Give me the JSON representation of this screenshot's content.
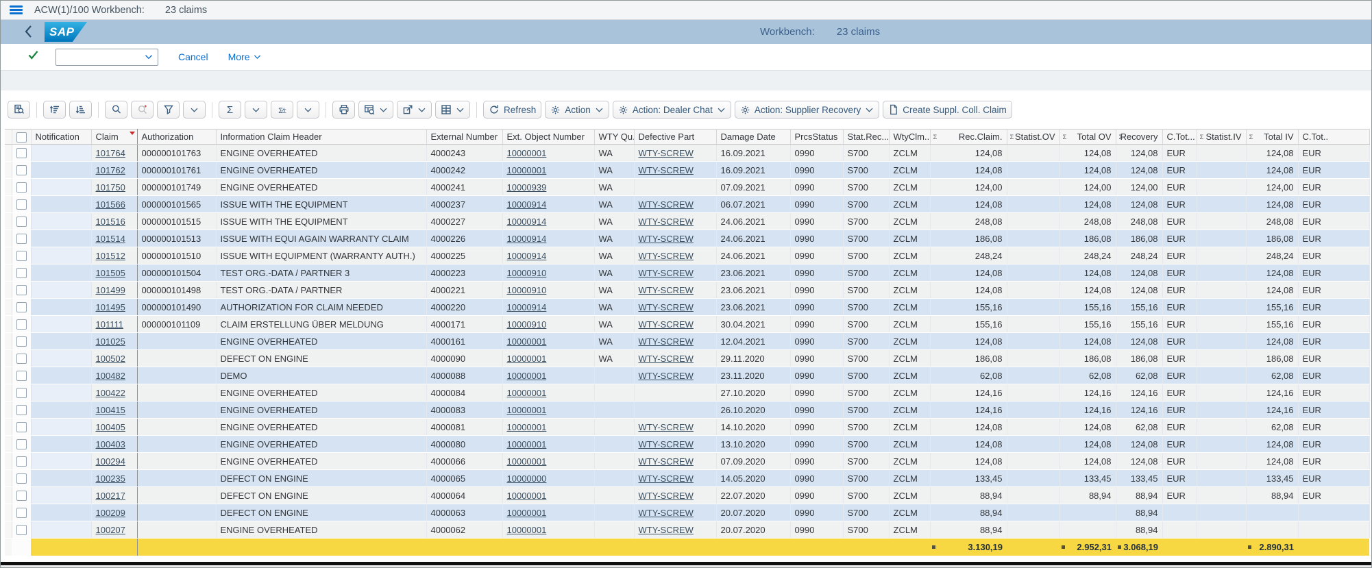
{
  "shell_bar": {
    "title": "ACW(1)/100 Workbench:",
    "claims_count": "23 claims"
  },
  "header_bar": {
    "logo_text": "SAP",
    "workbench_label": "Workbench:",
    "workbench_value": "23 claims"
  },
  "ok_code_bar": {
    "ok_field_value": "",
    "cancel_label": "Cancel",
    "more_label": "More"
  },
  "toolbar": {
    "buttons": [
      {
        "icon": "display-details-icon"
      },
      {
        "sep": true
      },
      {
        "icon": "sort-ascending-icon"
      },
      {
        "icon": "sort-descending-icon"
      },
      {
        "sep": true
      },
      {
        "icon": "find-icon"
      },
      {
        "icon": "find-next-icon",
        "disabled": true
      },
      {
        "icon": "filter-icon"
      },
      {
        "icon": "chevron-down-icon"
      },
      {
        "sep": true
      },
      {
        "icon": "sum-icon"
      },
      {
        "icon": "chevron-down-icon"
      },
      {
        "icon": "subtotal-icon"
      },
      {
        "icon": "chevron-down-icon"
      },
      {
        "sep": true
      },
      {
        "icon": "print-icon"
      },
      {
        "icon": "views-icon",
        "chevron": true
      },
      {
        "icon": "export-icon",
        "chevron": true
      },
      {
        "icon": "layout-icon",
        "chevron": true
      },
      {
        "sep": true
      },
      {
        "icon": "refresh-icon",
        "label": "Refresh"
      },
      {
        "icon": "gear-icon",
        "label": "Action",
        "chevron": true
      },
      {
        "icon": "gear-icon",
        "label": "Action: Dealer Chat",
        "chevron": true
      },
      {
        "icon": "gear-icon",
        "label": "Action: Supplier Recovery",
        "chevron": true
      },
      {
        "icon": "document-icon",
        "label": "Create Suppl. Coll. Claim"
      }
    ]
  },
  "table": {
    "columns": [
      {
        "label": "Notification"
      },
      {
        "label": "Claim",
        "sort": "desc"
      },
      {
        "label": "Authorization"
      },
      {
        "label": "Information Claim Header"
      },
      {
        "label": "External Number"
      },
      {
        "label": "Ext. Object Number"
      },
      {
        "label": "WTY Qu..."
      },
      {
        "label": "Defective Part"
      },
      {
        "label": "Damage Date"
      },
      {
        "label": "PrcsStatus"
      },
      {
        "label": "Stat.Rec..."
      },
      {
        "label": "WtyClm...",
        "sum_next": true
      },
      {
        "label": "Rec.Claim.",
        "num": true,
        "sum": true
      },
      {
        "label": "Statist.OV",
        "num": true,
        "sum": true
      },
      {
        "label": "Total OV",
        "num": true,
        "sum": true
      },
      {
        "label": "Recovery",
        "num": true,
        "sum": true
      },
      {
        "label": "C.Tot..."
      },
      {
        "label": "Statist.IV",
        "num": true,
        "sum": true
      },
      {
        "label": "Total IV",
        "num": true,
        "sum": true
      },
      {
        "label": "C.Tot.."
      }
    ],
    "rows": [
      {
        "notif": "",
        "claim": "101764",
        "auth": "000000101763",
        "info": "ENGINE OVERHEATED",
        "ext": "4000243",
        "obj": "10000001",
        "wty": "WA",
        "part": "WTY-SCREW",
        "date": "16.09.2021",
        "prcs": "0990",
        "stat": "S700",
        "typ": "ZCLM",
        "rec": "124,08",
        "sov": "",
        "tov": "124,08",
        "rcv": "124,08",
        "c1": "EUR",
        "siv": "",
        "tiv": "124,08",
        "c2": "EUR"
      },
      {
        "notif": "",
        "claim": "101762",
        "auth": "000000101761",
        "info": "ENGINE OVERHEATED",
        "ext": "4000242",
        "obj": "10000001",
        "wty": "WA",
        "part": "WTY-SCREW",
        "date": "16.09.2021",
        "prcs": "0990",
        "stat": "S700",
        "typ": "ZCLM",
        "rec": "124,08",
        "sov": "",
        "tov": "124,08",
        "rcv": "124,08",
        "c1": "EUR",
        "siv": "",
        "tiv": "124,08",
        "c2": "EUR"
      },
      {
        "notif": "",
        "claim": "101750",
        "auth": "000000101749",
        "info": "ENGINE OVERHEATED",
        "ext": "4000241",
        "obj": "10000939",
        "wty": "WA",
        "part": "",
        "date": "07.09.2021",
        "prcs": "0990",
        "stat": "S700",
        "typ": "ZCLM",
        "rec": "124,00",
        "sov": "",
        "tov": "124,00",
        "rcv": "124,00",
        "c1": "EUR",
        "siv": "",
        "tiv": "124,00",
        "c2": "EUR"
      },
      {
        "notif": "",
        "claim": "101566",
        "auth": "000000101565",
        "info": "ISSUE WITH THE EQUIPMENT",
        "ext": "4000237",
        "obj": "10000914",
        "wty": "WA",
        "part": "WTY-SCREW",
        "date": "06.07.2021",
        "prcs": "0990",
        "stat": "S700",
        "typ": "ZCLM",
        "rec": "124,08",
        "sov": "",
        "tov": "124,08",
        "rcv": "124,08",
        "c1": "EUR",
        "siv": "",
        "tiv": "124,08",
        "c2": "EUR"
      },
      {
        "notif": "",
        "claim": "101516",
        "auth": "000000101515",
        "info": "ISSUE WITH THE EQUIPMENT",
        "ext": "4000227",
        "obj": "10000914",
        "wty": "WA",
        "part": "WTY-SCREW",
        "date": "24.06.2021",
        "prcs": "0990",
        "stat": "S700",
        "typ": "ZCLM",
        "rec": "248,08",
        "sov": "",
        "tov": "248,08",
        "rcv": "248,08",
        "c1": "EUR",
        "siv": "",
        "tiv": "248,08",
        "c2": "EUR"
      },
      {
        "notif": "",
        "claim": "101514",
        "auth": "000000101513",
        "info": "ISSUE WITH EQUI AGAIN WARRANTY CLAIM",
        "ext": "4000226",
        "obj": "10000914",
        "wty": "WA",
        "part": "WTY-SCREW",
        "date": "24.06.2021",
        "prcs": "0990",
        "stat": "S700",
        "typ": "ZCLM",
        "rec": "186,08",
        "sov": "",
        "tov": "186,08",
        "rcv": "186,08",
        "c1": "EUR",
        "siv": "",
        "tiv": "186,08",
        "c2": "EUR"
      },
      {
        "notif": "",
        "claim": "101512",
        "auth": "000000101510",
        "info": "ISSUE WITH EQUIPMENT (WARRANTY AUTH.)",
        "ext": "4000225",
        "obj": "10000914",
        "wty": "WA",
        "part": "WTY-SCREW",
        "date": "24.06.2021",
        "prcs": "0990",
        "stat": "S700",
        "typ": "ZCLM",
        "rec": "248,24",
        "sov": "",
        "tov": "248,24",
        "rcv": "248,24",
        "c1": "EUR",
        "siv": "",
        "tiv": "248,24",
        "c2": "EUR"
      },
      {
        "notif": "",
        "claim": "101505",
        "auth": "000000101504",
        "info": "TEST ORG.-DATA / PARTNER 3",
        "ext": "4000223",
        "obj": "10000910",
        "wty": "WA",
        "part": "WTY-SCREW",
        "date": "23.06.2021",
        "prcs": "0990",
        "stat": "S700",
        "typ": "ZCLM",
        "rec": "124,08",
        "sov": "",
        "tov": "124,08",
        "rcv": "124,08",
        "c1": "EUR",
        "siv": "",
        "tiv": "124,08",
        "c2": "EUR"
      },
      {
        "notif": "",
        "claim": "101499",
        "auth": "000000101498",
        "info": "TEST ORG.-DATA / PARTNER",
        "ext": "4000221",
        "obj": "10000910",
        "wty": "WA",
        "part": "WTY-SCREW",
        "date": "23.06.2021",
        "prcs": "0990",
        "stat": "S700",
        "typ": "ZCLM",
        "rec": "124,08",
        "sov": "",
        "tov": "124,08",
        "rcv": "124,08",
        "c1": "EUR",
        "siv": "",
        "tiv": "124,08",
        "c2": "EUR"
      },
      {
        "notif": "",
        "claim": "101495",
        "auth": "000000101490",
        "info": "AUTHORIZATION FOR CLAIM NEEDED",
        "ext": "4000220",
        "obj": "10000914",
        "wty": "WA",
        "part": "WTY-SCREW",
        "date": "23.06.2021",
        "prcs": "0990",
        "stat": "S700",
        "typ": "ZCLM",
        "rec": "155,16",
        "sov": "",
        "tov": "155,16",
        "rcv": "155,16",
        "c1": "EUR",
        "siv": "",
        "tiv": "155,16",
        "c2": "EUR"
      },
      {
        "notif": "",
        "claim": "101111",
        "auth": "000000101109",
        "info": "CLAIM ERSTELLUNG ÜBER MELDUNG",
        "ext": "4000171",
        "obj": "10000910",
        "wty": "WA",
        "part": "WTY-SCREW",
        "date": "30.04.2021",
        "prcs": "0990",
        "stat": "S700",
        "typ": "ZCLM",
        "rec": "155,16",
        "sov": "",
        "tov": "155,16",
        "rcv": "155,16",
        "c1": "EUR",
        "siv": "",
        "tiv": "155,16",
        "c2": "EUR"
      },
      {
        "notif": "",
        "claim": "101025",
        "auth": "",
        "info": "ENGINE OVERHEATED",
        "ext": "4000161",
        "obj": "10000001",
        "wty": "WA",
        "part": "WTY-SCREW",
        "date": "12.04.2021",
        "prcs": "0990",
        "stat": "S700",
        "typ": "ZCLM",
        "rec": "124,08",
        "sov": "",
        "tov": "124,08",
        "rcv": "124,08",
        "c1": "EUR",
        "siv": "",
        "tiv": "124,08",
        "c2": "EUR"
      },
      {
        "notif": "",
        "claim": "100502",
        "auth": "",
        "info": "DEFECT ON ENGINE",
        "ext": "4000090",
        "obj": "10000001",
        "wty": "WA",
        "part": "WTY-SCREW",
        "date": "29.11.2020",
        "prcs": "0990",
        "stat": "S700",
        "typ": "ZCLM",
        "rec": "186,08",
        "sov": "",
        "tov": "186,08",
        "rcv": "186,08",
        "c1": "EUR",
        "siv": "",
        "tiv": "186,08",
        "c2": "EUR"
      },
      {
        "notif": "",
        "claim": "100482",
        "auth": "",
        "info": "DEMO",
        "ext": "4000088",
        "obj": "10000001",
        "wty": "",
        "part": "WTY-SCREW",
        "date": "23.11.2020",
        "prcs": "0990",
        "stat": "S700",
        "typ": "ZCLM",
        "rec": "62,08",
        "sov": "",
        "tov": "62,08",
        "rcv": "62,08",
        "c1": "EUR",
        "siv": "",
        "tiv": "62,08",
        "c2": "EUR"
      },
      {
        "notif": "",
        "claim": "100422",
        "auth": "",
        "info": "ENGINE OVERHEATED",
        "ext": "4000084",
        "obj": "10000001",
        "wty": "",
        "part": "",
        "date": "27.10.2020",
        "prcs": "0990",
        "stat": "S700",
        "typ": "ZCLM",
        "rec": "124,16",
        "sov": "",
        "tov": "124,16",
        "rcv": "124,16",
        "c1": "EUR",
        "siv": "",
        "tiv": "124,16",
        "c2": "EUR"
      },
      {
        "notif": "",
        "claim": "100415",
        "auth": "",
        "info": "ENGINE OVERHEATED",
        "ext": "4000083",
        "obj": "10000001",
        "wty": "",
        "part": "",
        "date": "26.10.2020",
        "prcs": "0990",
        "stat": "S700",
        "typ": "ZCLM",
        "rec": "124,16",
        "sov": "",
        "tov": "124,16",
        "rcv": "124,16",
        "c1": "EUR",
        "siv": "",
        "tiv": "124,16",
        "c2": "EUR"
      },
      {
        "notif": "",
        "claim": "100405",
        "auth": "",
        "info": "ENGINE OVERHEATED",
        "ext": "4000081",
        "obj": "10000001",
        "wty": "",
        "part": "WTY-SCREW",
        "date": "14.10.2020",
        "prcs": "0990",
        "stat": "S700",
        "typ": "ZCLM",
        "rec": "124,08",
        "sov": "",
        "tov": "124,08",
        "rcv": "62,08",
        "c1": "EUR",
        "siv": "",
        "tiv": "62,08",
        "c2": "EUR"
      },
      {
        "notif": "",
        "claim": "100403",
        "auth": "",
        "info": "ENGINE OVERHEATED",
        "ext": "4000080",
        "obj": "10000001",
        "wty": "",
        "part": "WTY-SCREW",
        "date": "13.10.2020",
        "prcs": "0990",
        "stat": "S700",
        "typ": "ZCLM",
        "rec": "124,08",
        "sov": "",
        "tov": "124,08",
        "rcv": "124,08",
        "c1": "EUR",
        "siv": "",
        "tiv": "124,08",
        "c2": "EUR"
      },
      {
        "notif": "",
        "claim": "100294",
        "auth": "",
        "info": "ENGINE OVERHEATED",
        "ext": "4000066",
        "obj": "10000001",
        "wty": "",
        "part": "WTY-SCREW",
        "date": "07.09.2020",
        "prcs": "0990",
        "stat": "S700",
        "typ": "ZCLM",
        "rec": "124,08",
        "sov": "",
        "tov": "124,08",
        "rcv": "124,08",
        "c1": "EUR",
        "siv": "",
        "tiv": "124,08",
        "c2": "EUR"
      },
      {
        "notif": "",
        "claim": "100235",
        "auth": "",
        "info": "DEFECT ON ENGINE",
        "ext": "4000065",
        "obj": "10000000",
        "wty": "",
        "part": "WTY-SCREW",
        "date": "14.05.2020",
        "prcs": "0990",
        "stat": "S700",
        "typ": "ZCLM",
        "rec": "133,45",
        "sov": "",
        "tov": "133,45",
        "rcv": "133,45",
        "c1": "EUR",
        "siv": "",
        "tiv": "133,45",
        "c2": "EUR"
      },
      {
        "notif": "",
        "claim": "100217",
        "auth": "",
        "info": "DEFECT ON ENGINE",
        "ext": "4000064",
        "obj": "10000001",
        "wty": "",
        "part": "WTY-SCREW",
        "date": "22.07.2020",
        "prcs": "0990",
        "stat": "S700",
        "typ": "ZCLM",
        "rec": "88,94",
        "sov": "",
        "tov": "88,94",
        "rcv": "88,94",
        "c1": "EUR",
        "siv": "",
        "tiv": "88,94",
        "c2": "EUR"
      },
      {
        "notif": "",
        "claim": "100209",
        "auth": "",
        "info": "DEFECT ON ENGINE",
        "ext": "4000063",
        "obj": "10000001",
        "wty": "",
        "part": "WTY-SCREW",
        "date": "20.07.2020",
        "prcs": "0990",
        "stat": "S700",
        "typ": "ZCLM",
        "rec": "88,94",
        "sov": "",
        "tov": "",
        "rcv": "88,94",
        "c1": "",
        "siv": "",
        "tiv": "",
        "c2": ""
      },
      {
        "notif": "",
        "claim": "100207",
        "auth": "",
        "info": "ENGINE OVERHEATED",
        "ext": "4000062",
        "obj": "10000001",
        "wty": "",
        "part": "WTY-SCREW",
        "date": "20.07.2020",
        "prcs": "0990",
        "stat": "S700",
        "typ": "ZCLM",
        "rec": "88,94",
        "sov": "",
        "tov": "",
        "rcv": "88,94",
        "c1": "",
        "siv": "",
        "tiv": "",
        "c2": ""
      }
    ],
    "totals": {
      "rec": "3.130,19",
      "tov": "2.952,31",
      "rcv": "3.068,19",
      "tiv": "2.890,31"
    }
  },
  "colors": {
    "accent_blue": "#0a6ed1",
    "header_bar_bg": "#a9c3da",
    "row_stripe_blue": "#d6e3f2",
    "row_stripe_light": "#f0f1f1",
    "totals_yellow": "#f7d742",
    "toolbar_icon": "#3c5e80",
    "check_green": "#17833c",
    "sort_caret_red": "#c92a2a"
  }
}
